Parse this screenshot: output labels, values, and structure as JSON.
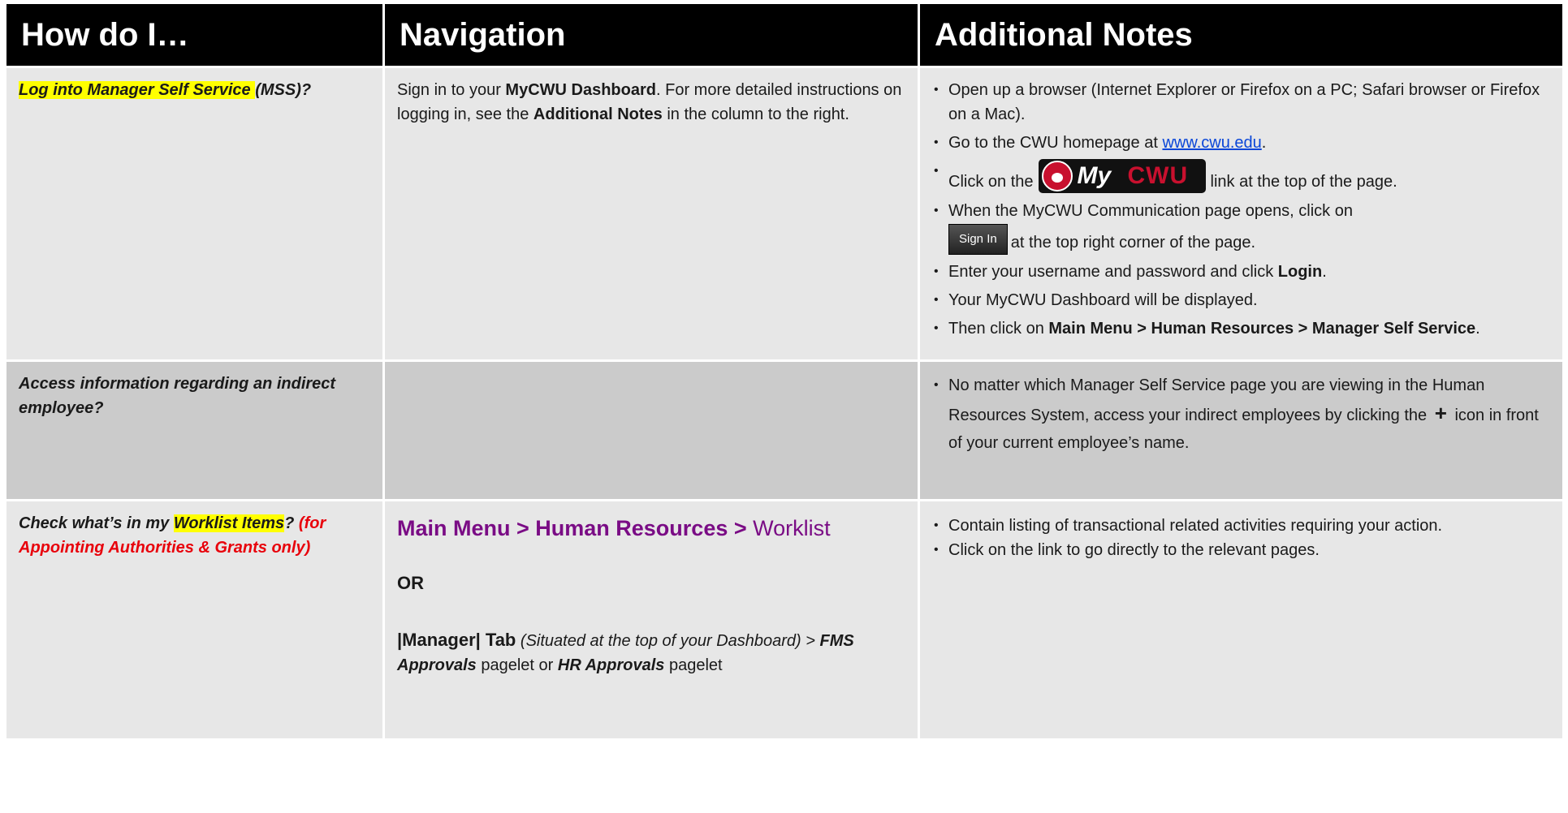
{
  "header": {
    "col1": "How do I…",
    "col2": "Navigation",
    "col3": "Additional Notes"
  },
  "row1": {
    "q_hl": "Log into Manager Self Service ",
    "q_rest": "(MSS)?",
    "nav_a": "Sign in to your ",
    "nav_b": "MyCWU Dashboard",
    "nav_c": ". For more detailed instructions on logging in, see the ",
    "nav_d": "Additional Notes",
    "nav_e": " in the column to the right.",
    "n1": "Open up a browser (Internet Explorer or Firefox on a PC; Safari browser or Firefox on a Mac).",
    "n2a": "Go to the CWU homepage at ",
    "n2link": "www.cwu.edu",
    "n2b": ".",
    "n3a": "Click on the",
    "logo_my": "My",
    "logo_cwu": "CWU",
    "n3b": "link at the top of the page.",
    "n4a": "When the MyCWU Communication page opens, click on",
    "signin": "Sign In",
    "n4b": "at the top right corner of the page.",
    "n5a": "Enter your username and password and click ",
    "n5b": "Login",
    "n5c": ".",
    "n6": "Your MyCWU Dashboard will be displayed.",
    "n7a": "Then click on ",
    "n7b": "Main Menu > Human Resources > Manager Self Service",
    "n7c": "."
  },
  "row2": {
    "q": "Access information regarding an indirect employee?",
    "n1a": "No matter which Manager Self Service page you are viewing in the Human Resources System, access your indirect employees by clicking the",
    "plus": "+",
    "n1b": "icon in front of your current employee’s name."
  },
  "row3": {
    "q_a": "Check what’s in my ",
    "q_hl": "Worklist Items",
    "q_b": "?",
    "q_red": " (for Appointing Authorities & Grants only)",
    "nav_path_bold": "Main Menu > Human Resources > ",
    "nav_path_end": "Worklist",
    "or": "OR",
    "m1": "|Manager| Tab",
    "m2": " (Situated at the top of your Dashboard) > ",
    "m3": "FMS Approvals",
    "m4": " pagelet or ",
    "m5": "HR Approvals",
    "m6": " pagelet",
    "n1": "Contain listing of transactional related activities requiring your action.",
    "n2": "Click on the link to go directly to the relevant pages."
  }
}
